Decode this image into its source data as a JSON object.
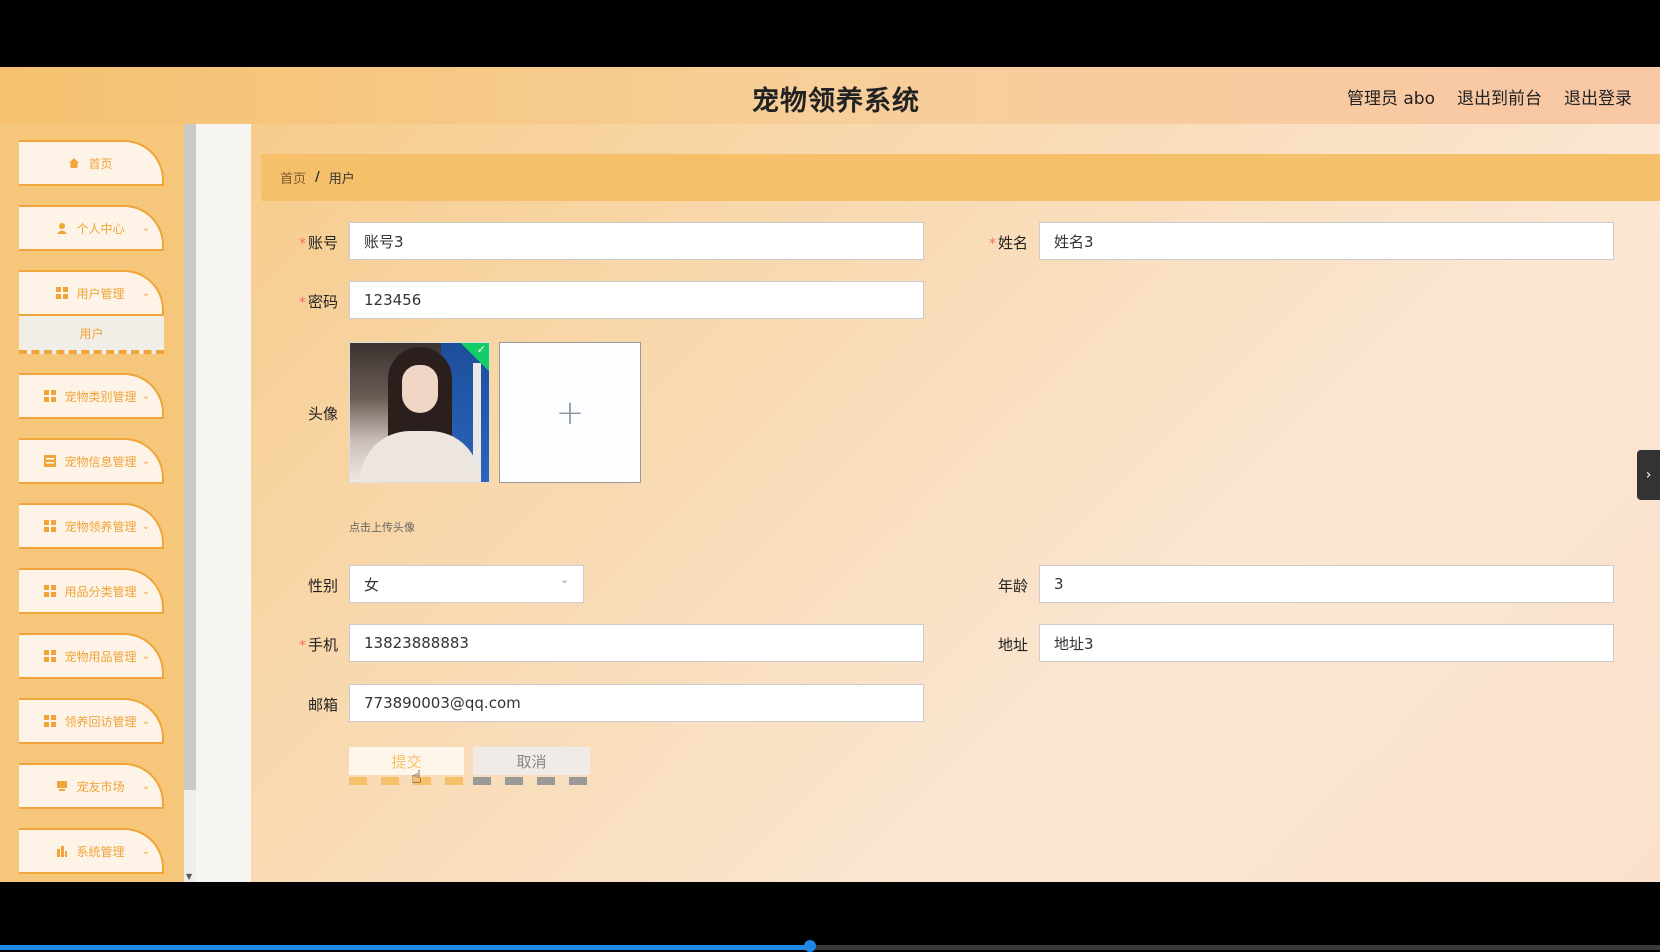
{
  "header": {
    "title": "宠物领养系统",
    "admin_label": "管理员 abo",
    "front_link": "退出到前台",
    "logout_link": "退出登录"
  },
  "sidebar": {
    "items": [
      {
        "label": "首页",
        "icon": "home-icon"
      },
      {
        "label": "个人中心",
        "icon": "user-icon"
      },
      {
        "label": "用户管理",
        "icon": "grid-icon"
      },
      {
        "label": "宠物类别管理",
        "icon": "grid-icon"
      },
      {
        "label": "宠物信息管理",
        "icon": "form-icon"
      },
      {
        "label": "宠物领养管理",
        "icon": "grid-icon"
      },
      {
        "label": "用品分类管理",
        "icon": "grid-icon"
      },
      {
        "label": "宠物用品管理",
        "icon": "grid-icon"
      },
      {
        "label": "领养回访管理",
        "icon": "grid-icon"
      },
      {
        "label": "宠友市场",
        "icon": "chat-icon"
      },
      {
        "label": "系统管理",
        "icon": "chart-icon"
      }
    ],
    "sub_item": "用户"
  },
  "breadcrumb": {
    "home": "首页",
    "separator": "/",
    "current": "用户"
  },
  "form": {
    "account_label": "账号",
    "account_value": "账号3",
    "name_label": "姓名",
    "name_value": "姓名3",
    "password_label": "密码",
    "password_value": "123456",
    "avatar_label": "头像",
    "avatar_tip": "点击上传头像",
    "upload_plus": "+",
    "gender_label": "性别",
    "gender_value": "女",
    "age_label": "年龄",
    "age_value": "3",
    "phone_label": "手机",
    "phone_value": "13823888883",
    "address_label": "地址",
    "address_value": "地址3",
    "email_label": "邮箱",
    "email_value": "773890003@qq.com",
    "required_mark": "*"
  },
  "buttons": {
    "submit": "提交",
    "cancel": "取消"
  },
  "colors": {
    "accent": "#f0a43a",
    "required": "#f56c6c",
    "breadcrumb_bg": "#f6c06a"
  }
}
